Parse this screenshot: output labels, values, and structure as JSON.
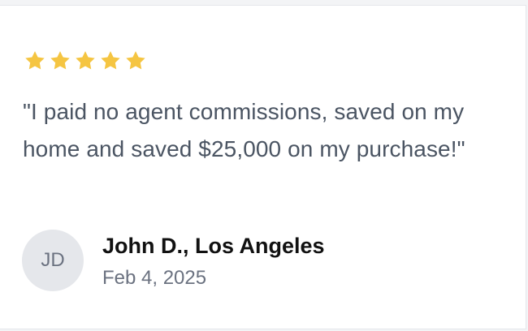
{
  "review": {
    "rating": 5,
    "rating_max": 5,
    "star_color": "#f5c542",
    "quote": "\"I paid no agent commissions, saved on my home and saved $25,000 on my purchase!\"",
    "author": {
      "initials": "JD",
      "name": "John D., Los Angeles",
      "date": "Feb 4, 2025"
    }
  }
}
